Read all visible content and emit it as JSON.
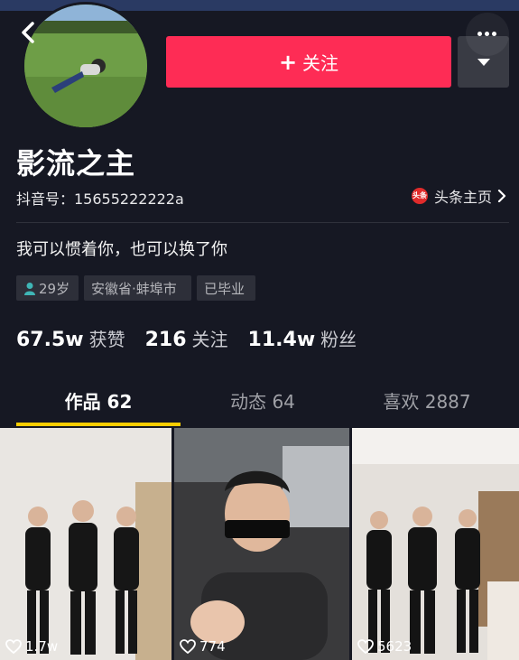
{
  "header": {
    "follow_label": "关注",
    "follow_plus": "+"
  },
  "profile": {
    "name": "影流之主",
    "douyin_id": "抖音号：15655222222a",
    "toutiao_logo_text": "头条",
    "toutiao_link": "头条主页",
    "bio": "我可以惯着你，也可以换了你",
    "tags": {
      "age": "29岁",
      "location": "安徽省·蚌埠市",
      "school": "已毕业"
    }
  },
  "stats": [
    {
      "num": "67.5w",
      "label": "获赞"
    },
    {
      "num": "216",
      "label": "关注"
    },
    {
      "num": "11.4w",
      "label": "粉丝"
    }
  ],
  "tabs": [
    {
      "label": "作品 62",
      "active": true
    },
    {
      "label": "动态 64",
      "active": false
    },
    {
      "label": "喜欢 2887",
      "active": false
    }
  ],
  "videos": [
    {
      "likes": "1.7w"
    },
    {
      "likes": "774"
    },
    {
      "likes": "5623"
    }
  ],
  "colors": {
    "background": "#161823",
    "follow_button": "#fe2c55",
    "tab_indicator": "#facd00"
  },
  "icons": [
    "back-arrow-icon",
    "more-dots-icon",
    "dropdown-triangle-icon",
    "toutiao-logo-icon",
    "chevron-right-icon",
    "person-icon",
    "heart-outline-icon"
  ]
}
